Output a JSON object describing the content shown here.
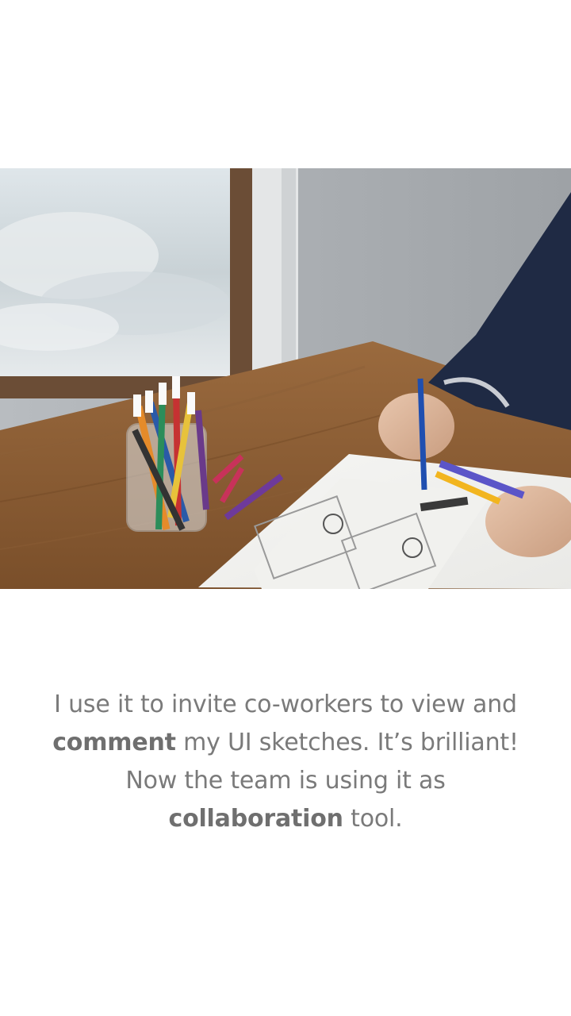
{
  "onboarding": {
    "photo_icon": "sketching-photo",
    "testimonial": {
      "part1": "I use it to invite co-workers to view and ",
      "emphasis1": "comment",
      "part2": " my UI sketches. It’s brilliant! Now the team is using it as ",
      "emphasis2": "collaboration",
      "part3": " tool."
    }
  }
}
